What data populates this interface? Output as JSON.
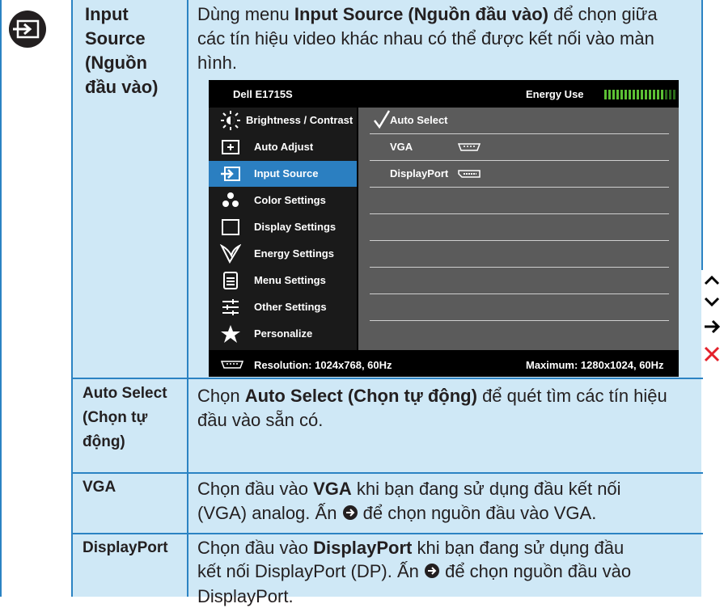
{
  "header_row": {
    "label_lines": [
      "Input",
      "Source",
      "(Nguồn",
      "đầu vào)"
    ],
    "desc_pre": "Dùng menu ",
    "desc_bold": "Input Source (Nguồn đầu vào)",
    "desc_line1_post": " để chọn giữa",
    "desc_line2": "các tín hiệu video khác nhau có thể được kết nối vào màn",
    "desc_line3": "hình."
  },
  "osd": {
    "title": "Dell E1715S",
    "energy_label": "Energy Use",
    "energy_level": 0.86,
    "menu": [
      {
        "label": "Brightness / Contrast",
        "icon": "brightness-icon"
      },
      {
        "label": "Auto Adjust",
        "icon": "auto-adjust-icon"
      },
      {
        "label": "Input Source",
        "icon": "input-source-icon"
      },
      {
        "label": "Color Settings",
        "icon": "color-settings-icon"
      },
      {
        "label": "Display Settings",
        "icon": "display-settings-icon"
      },
      {
        "label": "Energy Settings",
        "icon": "energy-settings-icon"
      },
      {
        "label": "Menu Settings",
        "icon": "menu-settings-icon"
      },
      {
        "label": "Other Settings",
        "icon": "other-settings-icon"
      },
      {
        "label": "Personalize",
        "icon": "star-icon"
      }
    ],
    "selected_index": 2,
    "options": [
      {
        "label": "Auto Select",
        "checked": true
      },
      {
        "label": "VGA",
        "checked": false
      },
      {
        "label": "DisplayPort",
        "checked": false
      }
    ],
    "resolution": "Resolution: 1024x768, 60Hz",
    "maximum": "Maximum: 1280x1024, 60Hz"
  },
  "rows": [
    {
      "label_lines": [
        "Auto Select",
        "(Chọn tự",
        "động)"
      ],
      "pre": "Chọn ",
      "bold": "Auto Select (Chọn tự động)",
      "post": " để quét tìm các tín hiệu",
      "line2": "đầu vào sẵn có."
    },
    {
      "label_lines": [
        "VGA"
      ],
      "pre": "Chọn đầu vào ",
      "bold": "VGA",
      "post": " khi bạn đang sử dụng đầu kết nối",
      "line2_pre": "(VGA) analog. Ấn ",
      "line2_post": " để chọn nguồn đầu vào VGA."
    },
    {
      "label_lines": [
        "DisplayPort"
      ],
      "pre": "Chọn đầu vào ",
      "bold": "DisplayPort",
      "post": " khi bạn đang sử dụng đầu",
      "line2_pre": "kết nối DisplayPort (DP). Ấn ",
      "line2_post": " để chọn nguồn đầu vào",
      "line3": "DisplayPort."
    }
  ],
  "colors": {
    "border": "#2b83c3",
    "cell_bg": "#cfe8f6",
    "osd_selected": "#2b7fc1",
    "nav_close": "#e3202a"
  }
}
